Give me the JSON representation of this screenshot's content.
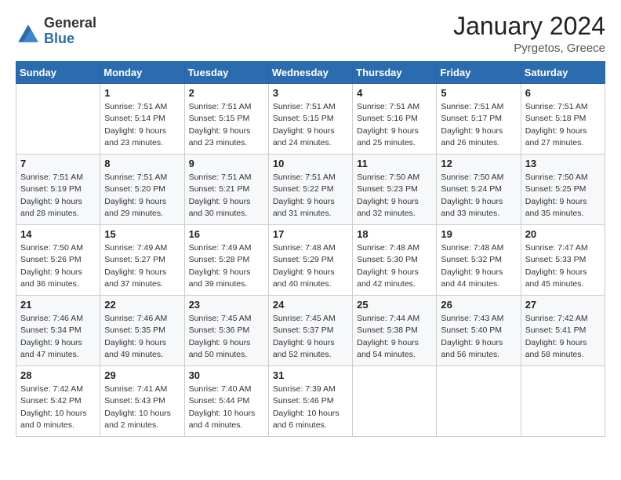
{
  "logo": {
    "general": "General",
    "blue": "Blue"
  },
  "title": {
    "month_year": "January 2024",
    "location": "Pyrgetos, Greece"
  },
  "days_of_week": [
    "Sunday",
    "Monday",
    "Tuesday",
    "Wednesday",
    "Thursday",
    "Friday",
    "Saturday"
  ],
  "weeks": [
    [
      {
        "day": "",
        "sunrise": "",
        "sunset": "",
        "daylight": ""
      },
      {
        "day": "1",
        "sunrise": "Sunrise: 7:51 AM",
        "sunset": "Sunset: 5:14 PM",
        "daylight": "Daylight: 9 hours and 23 minutes."
      },
      {
        "day": "2",
        "sunrise": "Sunrise: 7:51 AM",
        "sunset": "Sunset: 5:15 PM",
        "daylight": "Daylight: 9 hours and 23 minutes."
      },
      {
        "day": "3",
        "sunrise": "Sunrise: 7:51 AM",
        "sunset": "Sunset: 5:15 PM",
        "daylight": "Daylight: 9 hours and 24 minutes."
      },
      {
        "day": "4",
        "sunrise": "Sunrise: 7:51 AM",
        "sunset": "Sunset: 5:16 PM",
        "daylight": "Daylight: 9 hours and 25 minutes."
      },
      {
        "day": "5",
        "sunrise": "Sunrise: 7:51 AM",
        "sunset": "Sunset: 5:17 PM",
        "daylight": "Daylight: 9 hours and 26 minutes."
      },
      {
        "day": "6",
        "sunrise": "Sunrise: 7:51 AM",
        "sunset": "Sunset: 5:18 PM",
        "daylight": "Daylight: 9 hours and 27 minutes."
      }
    ],
    [
      {
        "day": "7",
        "sunrise": "Sunrise: 7:51 AM",
        "sunset": "Sunset: 5:19 PM",
        "daylight": "Daylight: 9 hours and 28 minutes."
      },
      {
        "day": "8",
        "sunrise": "Sunrise: 7:51 AM",
        "sunset": "Sunset: 5:20 PM",
        "daylight": "Daylight: 9 hours and 29 minutes."
      },
      {
        "day": "9",
        "sunrise": "Sunrise: 7:51 AM",
        "sunset": "Sunset: 5:21 PM",
        "daylight": "Daylight: 9 hours and 30 minutes."
      },
      {
        "day": "10",
        "sunrise": "Sunrise: 7:51 AM",
        "sunset": "Sunset: 5:22 PM",
        "daylight": "Daylight: 9 hours and 31 minutes."
      },
      {
        "day": "11",
        "sunrise": "Sunrise: 7:50 AM",
        "sunset": "Sunset: 5:23 PM",
        "daylight": "Daylight: 9 hours and 32 minutes."
      },
      {
        "day": "12",
        "sunrise": "Sunrise: 7:50 AM",
        "sunset": "Sunset: 5:24 PM",
        "daylight": "Daylight: 9 hours and 33 minutes."
      },
      {
        "day": "13",
        "sunrise": "Sunrise: 7:50 AM",
        "sunset": "Sunset: 5:25 PM",
        "daylight": "Daylight: 9 hours and 35 minutes."
      }
    ],
    [
      {
        "day": "14",
        "sunrise": "Sunrise: 7:50 AM",
        "sunset": "Sunset: 5:26 PM",
        "daylight": "Daylight: 9 hours and 36 minutes."
      },
      {
        "day": "15",
        "sunrise": "Sunrise: 7:49 AM",
        "sunset": "Sunset: 5:27 PM",
        "daylight": "Daylight: 9 hours and 37 minutes."
      },
      {
        "day": "16",
        "sunrise": "Sunrise: 7:49 AM",
        "sunset": "Sunset: 5:28 PM",
        "daylight": "Daylight: 9 hours and 39 minutes."
      },
      {
        "day": "17",
        "sunrise": "Sunrise: 7:48 AM",
        "sunset": "Sunset: 5:29 PM",
        "daylight": "Daylight: 9 hours and 40 minutes."
      },
      {
        "day": "18",
        "sunrise": "Sunrise: 7:48 AM",
        "sunset": "Sunset: 5:30 PM",
        "daylight": "Daylight: 9 hours and 42 minutes."
      },
      {
        "day": "19",
        "sunrise": "Sunrise: 7:48 AM",
        "sunset": "Sunset: 5:32 PM",
        "daylight": "Daylight: 9 hours and 44 minutes."
      },
      {
        "day": "20",
        "sunrise": "Sunrise: 7:47 AM",
        "sunset": "Sunset: 5:33 PM",
        "daylight": "Daylight: 9 hours and 45 minutes."
      }
    ],
    [
      {
        "day": "21",
        "sunrise": "Sunrise: 7:46 AM",
        "sunset": "Sunset: 5:34 PM",
        "daylight": "Daylight: 9 hours and 47 minutes."
      },
      {
        "day": "22",
        "sunrise": "Sunrise: 7:46 AM",
        "sunset": "Sunset: 5:35 PM",
        "daylight": "Daylight: 9 hours and 49 minutes."
      },
      {
        "day": "23",
        "sunrise": "Sunrise: 7:45 AM",
        "sunset": "Sunset: 5:36 PM",
        "daylight": "Daylight: 9 hours and 50 minutes."
      },
      {
        "day": "24",
        "sunrise": "Sunrise: 7:45 AM",
        "sunset": "Sunset: 5:37 PM",
        "daylight": "Daylight: 9 hours and 52 minutes."
      },
      {
        "day": "25",
        "sunrise": "Sunrise: 7:44 AM",
        "sunset": "Sunset: 5:38 PM",
        "daylight": "Daylight: 9 hours and 54 minutes."
      },
      {
        "day": "26",
        "sunrise": "Sunrise: 7:43 AM",
        "sunset": "Sunset: 5:40 PM",
        "daylight": "Daylight: 9 hours and 56 minutes."
      },
      {
        "day": "27",
        "sunrise": "Sunrise: 7:42 AM",
        "sunset": "Sunset: 5:41 PM",
        "daylight": "Daylight: 9 hours and 58 minutes."
      }
    ],
    [
      {
        "day": "28",
        "sunrise": "Sunrise: 7:42 AM",
        "sunset": "Sunset: 5:42 PM",
        "daylight": "Daylight: 10 hours and 0 minutes."
      },
      {
        "day": "29",
        "sunrise": "Sunrise: 7:41 AM",
        "sunset": "Sunset: 5:43 PM",
        "daylight": "Daylight: 10 hours and 2 minutes."
      },
      {
        "day": "30",
        "sunrise": "Sunrise: 7:40 AM",
        "sunset": "Sunset: 5:44 PM",
        "daylight": "Daylight: 10 hours and 4 minutes."
      },
      {
        "day": "31",
        "sunrise": "Sunrise: 7:39 AM",
        "sunset": "Sunset: 5:46 PM",
        "daylight": "Daylight: 10 hours and 6 minutes."
      },
      {
        "day": "",
        "sunrise": "",
        "sunset": "",
        "daylight": ""
      },
      {
        "day": "",
        "sunrise": "",
        "sunset": "",
        "daylight": ""
      },
      {
        "day": "",
        "sunrise": "",
        "sunset": "",
        "daylight": ""
      }
    ]
  ]
}
